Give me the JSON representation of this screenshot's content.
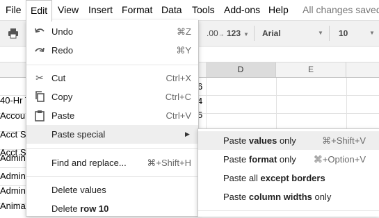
{
  "menubar": {
    "items": [
      "File",
      "Edit",
      "View",
      "Insert",
      "Format",
      "Data",
      "Tools",
      "Add-ons",
      "Help"
    ],
    "status": "All changes saved"
  },
  "toolbar": {
    "decimal_label": ".00",
    "number_format": "123",
    "font_name": "Arial",
    "font_size": "10"
  },
  "columns": {
    "d": "D",
    "e": "E"
  },
  "grid": {
    "col_a": [
      "40-Hr T",
      "Accou",
      "Acct Sp",
      "Acct Sp",
      "Admin",
      "Admin",
      "Admin",
      "Animal"
    ],
    "col_c": [
      "6",
      "4",
      "5"
    ]
  },
  "edit_menu": {
    "items": [
      {
        "label": "Undo",
        "shortcut": "⌘Z"
      },
      {
        "label": "Redo",
        "shortcut": "⌘Y"
      },
      {
        "label": "Cut",
        "shortcut": "Ctrl+X"
      },
      {
        "label": "Copy",
        "shortcut": "Ctrl+C"
      },
      {
        "label": "Paste",
        "shortcut": "Ctrl+V"
      },
      {
        "label": "Paste special",
        "shortcut": ""
      },
      {
        "label": "Find and replace...",
        "shortcut": "⌘+Shift+H"
      },
      {
        "label": "Delete values",
        "shortcut": ""
      },
      {
        "label_pre": "Delete ",
        "label_bold": "row 10"
      }
    ]
  },
  "paste_special_menu": {
    "items": [
      {
        "pre": "Paste ",
        "bold": "values",
        "post": " only",
        "shortcut": "⌘+Shift+V"
      },
      {
        "pre": "Paste ",
        "bold": "format",
        "post": " only",
        "shortcut": "⌘+Option+V"
      },
      {
        "pre": "Paste all ",
        "bold": "except borders",
        "post": "",
        "shortcut": ""
      },
      {
        "pre": "Paste ",
        "bold": "column widths",
        "post": " only",
        "shortcut": ""
      }
    ]
  }
}
